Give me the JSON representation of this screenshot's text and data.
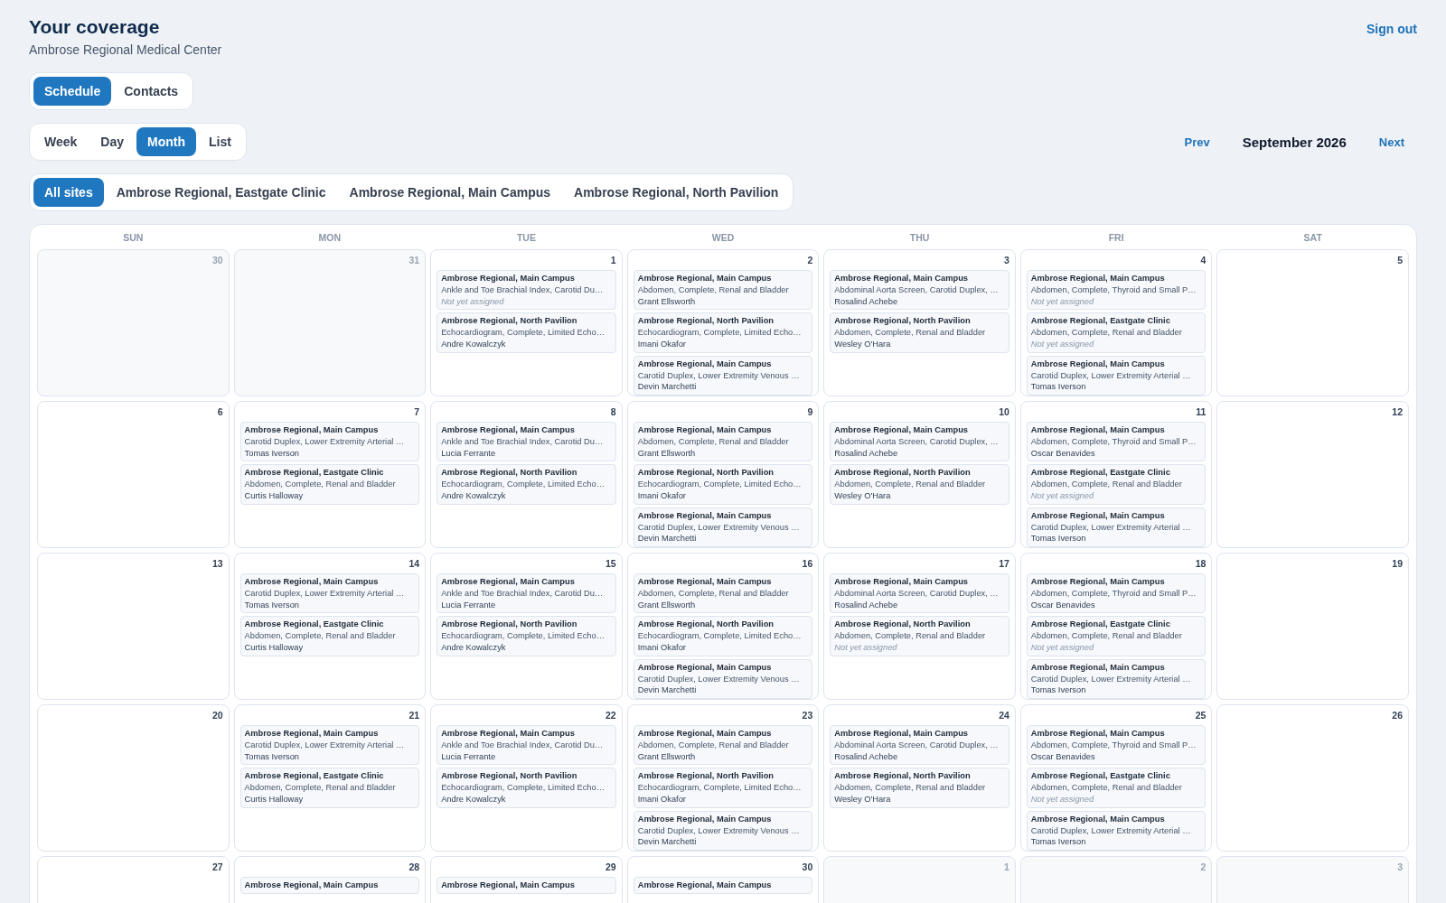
{
  "header": {
    "title": "Your coverage",
    "subtitle": "Ambrose Regional Medical Center",
    "sign_out": "Sign out"
  },
  "tabs": [
    {
      "label": "Schedule",
      "selected": true
    },
    {
      "label": "Contacts",
      "selected": false
    }
  ],
  "views": [
    {
      "label": "Week",
      "selected": false
    },
    {
      "label": "Day",
      "selected": false
    },
    {
      "label": "Month",
      "selected": true
    },
    {
      "label": "List",
      "selected": false
    }
  ],
  "nav": {
    "prev": "Prev",
    "month": "September 2026",
    "next": "Next"
  },
  "sites": [
    {
      "label": "All sites",
      "selected": true
    },
    {
      "label": "Ambrose Regional, Eastgate Clinic",
      "selected": false
    },
    {
      "label": "Ambrose Regional, Main Campus",
      "selected": false
    },
    {
      "label": "Ambrose Regional, North Pavilion",
      "selected": false
    }
  ],
  "calendar": {
    "weekdays": [
      "SUN",
      "MON",
      "TUE",
      "WED",
      "THU",
      "FRI",
      "SAT"
    ],
    "weeks": [
      {
        "days": [
          {
            "day": "30",
            "outside": true
          },
          {
            "day": "31",
            "outside": true
          },
          {
            "day": "1",
            "outside": false,
            "events": [
              {
                "site": "Ambrose Regional, Main Campus",
                "procedure": "Ankle and Toe Brachial Index, Carotid Du…",
                "assignee": "Not yet assigned",
                "assigned": false
              },
              {
                "site": "Ambrose Regional, North Pavilion",
                "procedure": "Echocardiogram, Complete, Limited Echo…",
                "assignee": "Andre Kowalczyk",
                "assigned": true
              }
            ]
          },
          {
            "day": "2",
            "outside": false,
            "events": [
              {
                "site": "Ambrose Regional, Main Campus",
                "procedure": "Abdomen, Complete, Renal and Bladder",
                "assignee": "Grant Ellsworth",
                "assigned": true
              },
              {
                "site": "Ambrose Regional, North Pavilion",
                "procedure": "Echocardiogram, Complete, Limited Echo…",
                "assignee": "Imani Okafor",
                "assigned": true
              },
              {
                "site": "Ambrose Regional, Main Campus",
                "procedure": "Carotid Duplex, Lower Extremity Venous …",
                "assignee": "Devin Marchetti",
                "assigned": true
              }
            ]
          },
          {
            "day": "3",
            "outside": false,
            "events": [
              {
                "site": "Ambrose Regional, Main Campus",
                "procedure": "Abdominal Aorta Screen, Carotid Duplex, …",
                "assignee": "Rosalind Achebe",
                "assigned": true
              },
              {
                "site": "Ambrose Regional, North Pavilion",
                "procedure": "Abdomen, Complete, Renal and Bladder",
                "assignee": "Wesley O'Hara",
                "assigned": true
              }
            ]
          },
          {
            "day": "4",
            "outside": false,
            "events": [
              {
                "site": "Ambrose Regional, Main Campus",
                "procedure": "Abdomen, Complete, Thyroid and Small P…",
                "assignee": "Not yet assigned",
                "assigned": false
              },
              {
                "site": "Ambrose Regional, Eastgate Clinic",
                "procedure": "Abdomen, Complete, Renal and Bladder",
                "assignee": "Not yet assigned",
                "assigned": false
              },
              {
                "site": "Ambrose Regional, Main Campus",
                "procedure": "Carotid Duplex, Lower Extremity Arterial …",
                "assignee": "Tomas Iverson",
                "assigned": true
              }
            ]
          },
          {
            "day": "5",
            "outside": false
          }
        ]
      },
      {
        "days": [
          {
            "day": "6",
            "outside": false
          },
          {
            "day": "7",
            "outside": false,
            "events": [
              {
                "site": "Ambrose Regional, Main Campus",
                "procedure": "Carotid Duplex, Lower Extremity Arterial …",
                "assignee": "Tomas Iverson",
                "assigned": true
              },
              {
                "site": "Ambrose Regional, Eastgate Clinic",
                "procedure": "Abdomen, Complete, Renal and Bladder",
                "assignee": "Curtis Halloway",
                "assigned": true
              }
            ]
          },
          {
            "day": "8",
            "outside": false,
            "events": [
              {
                "site": "Ambrose Regional, Main Campus",
                "procedure": "Ankle and Toe Brachial Index, Carotid Du…",
                "assignee": "Lucia Ferrante",
                "assigned": true
              },
              {
                "site": "Ambrose Regional, North Pavilion",
                "procedure": "Echocardiogram, Complete, Limited Echo…",
                "assignee": "Andre Kowalczyk",
                "assigned": true
              }
            ]
          },
          {
            "day": "9",
            "outside": false,
            "events": [
              {
                "site": "Ambrose Regional, Main Campus",
                "procedure": "Abdomen, Complete, Renal and Bladder",
                "assignee": "Grant Ellsworth",
                "assigned": true
              },
              {
                "site": "Ambrose Regional, North Pavilion",
                "procedure": "Echocardiogram, Complete, Limited Echo…",
                "assignee": "Imani Okafor",
                "assigned": true
              },
              {
                "site": "Ambrose Regional, Main Campus",
                "procedure": "Carotid Duplex, Lower Extremity Venous …",
                "assignee": "Devin Marchetti",
                "assigned": true
              }
            ]
          },
          {
            "day": "10",
            "outside": false,
            "events": [
              {
                "site": "Ambrose Regional, Main Campus",
                "procedure": "Abdominal Aorta Screen, Carotid Duplex, …",
                "assignee": "Rosalind Achebe",
                "assigned": true
              },
              {
                "site": "Ambrose Regional, North Pavilion",
                "procedure": "Abdomen, Complete, Renal and Bladder",
                "assignee": "Wesley O'Hara",
                "assigned": true
              }
            ]
          },
          {
            "day": "11",
            "outside": false,
            "events": [
              {
                "site": "Ambrose Regional, Main Campus",
                "procedure": "Abdomen, Complete, Thyroid and Small P…",
                "assignee": "Oscar Benavides",
                "assigned": true
              },
              {
                "site": "Ambrose Regional, Eastgate Clinic",
                "procedure": "Abdomen, Complete, Renal and Bladder",
                "assignee": "Not yet assigned",
                "assigned": false
              },
              {
                "site": "Ambrose Regional, Main Campus",
                "procedure": "Carotid Duplex, Lower Extremity Arterial …",
                "assignee": "Tomas Iverson",
                "assigned": true
              }
            ]
          },
          {
            "day": "12",
            "outside": false
          }
        ]
      },
      {
        "days": [
          {
            "day": "13",
            "outside": false
          },
          {
            "day": "14",
            "outside": false,
            "events": [
              {
                "site": "Ambrose Regional, Main Campus",
                "procedure": "Carotid Duplex, Lower Extremity Arterial …",
                "assignee": "Tomas Iverson",
                "assigned": true
              },
              {
                "site": "Ambrose Regional, Eastgate Clinic",
                "procedure": "Abdomen, Complete, Renal and Bladder",
                "assignee": "Curtis Halloway",
                "assigned": true
              }
            ]
          },
          {
            "day": "15",
            "outside": false,
            "events": [
              {
                "site": "Ambrose Regional, Main Campus",
                "procedure": "Ankle and Toe Brachial Index, Carotid Du…",
                "assignee": "Lucia Ferrante",
                "assigned": true
              },
              {
                "site": "Ambrose Regional, North Pavilion",
                "procedure": "Echocardiogram, Complete, Limited Echo…",
                "assignee": "Andre Kowalczyk",
                "assigned": true
              }
            ]
          },
          {
            "day": "16",
            "outside": false,
            "events": [
              {
                "site": "Ambrose Regional, Main Campus",
                "procedure": "Abdomen, Complete, Renal and Bladder",
                "assignee": "Grant Ellsworth",
                "assigned": true
              },
              {
                "site": "Ambrose Regional, North Pavilion",
                "procedure": "Echocardiogram, Complete, Limited Echo…",
                "assignee": "Imani Okafor",
                "assigned": true
              },
              {
                "site": "Ambrose Regional, Main Campus",
                "procedure": "Carotid Duplex, Lower Extremity Venous …",
                "assignee": "Devin Marchetti",
                "assigned": true
              }
            ]
          },
          {
            "day": "17",
            "outside": false,
            "events": [
              {
                "site": "Ambrose Regional, Main Campus",
                "procedure": "Abdominal Aorta Screen, Carotid Duplex, …",
                "assignee": "Rosalind Achebe",
                "assigned": true
              },
              {
                "site": "Ambrose Regional, North Pavilion",
                "procedure": "Abdomen, Complete, Renal and Bladder",
                "assignee": "Not yet assigned",
                "assigned": false
              }
            ]
          },
          {
            "day": "18",
            "outside": false,
            "events": [
              {
                "site": "Ambrose Regional, Main Campus",
                "procedure": "Abdomen, Complete, Thyroid and Small P…",
                "assignee": "Oscar Benavides",
                "assigned": true
              },
              {
                "site": "Ambrose Regional, Eastgate Clinic",
                "procedure": "Abdomen, Complete, Renal and Bladder",
                "assignee": "Not yet assigned",
                "assigned": false
              },
              {
                "site": "Ambrose Regional, Main Campus",
                "procedure": "Carotid Duplex, Lower Extremity Arterial …",
                "assignee": "Tomas Iverson",
                "assigned": true
              }
            ]
          },
          {
            "day": "19",
            "outside": false
          }
        ]
      },
      {
        "days": [
          {
            "day": "20",
            "outside": false
          },
          {
            "day": "21",
            "outside": false,
            "events": [
              {
                "site": "Ambrose Regional, Main Campus",
                "procedure": "Carotid Duplex, Lower Extremity Arterial …",
                "assignee": "Tomas Iverson",
                "assigned": true
              },
              {
                "site": "Ambrose Regional, Eastgate Clinic",
                "procedure": "Abdomen, Complete, Renal and Bladder",
                "assignee": "Curtis Halloway",
                "assigned": true
              }
            ]
          },
          {
            "day": "22",
            "outside": false,
            "events": [
              {
                "site": "Ambrose Regional, Main Campus",
                "procedure": "Ankle and Toe Brachial Index, Carotid Du…",
                "assignee": "Lucia Ferrante",
                "assigned": true
              },
              {
                "site": "Ambrose Regional, North Pavilion",
                "procedure": "Echocardiogram, Complete, Limited Echo…",
                "assignee": "Andre Kowalczyk",
                "assigned": true
              }
            ]
          },
          {
            "day": "23",
            "outside": false,
            "events": [
              {
                "site": "Ambrose Regional, Main Campus",
                "procedure": "Abdomen, Complete, Renal and Bladder",
                "assignee": "Grant Ellsworth",
                "assigned": true
              },
              {
                "site": "Ambrose Regional, North Pavilion",
                "procedure": "Echocardiogram, Complete, Limited Echo…",
                "assignee": "Imani Okafor",
                "assigned": true
              },
              {
                "site": "Ambrose Regional, Main Campus",
                "procedure": "Carotid Duplex, Lower Extremity Venous …",
                "assignee": "Devin Marchetti",
                "assigned": true
              }
            ]
          },
          {
            "day": "24",
            "outside": false,
            "events": [
              {
                "site": "Ambrose Regional, Main Campus",
                "procedure": "Abdominal Aorta Screen, Carotid Duplex, …",
                "assignee": "Rosalind Achebe",
                "assigned": true
              },
              {
                "site": "Ambrose Regional, North Pavilion",
                "procedure": "Abdomen, Complete, Renal and Bladder",
                "assignee": "Wesley O'Hara",
                "assigned": true
              }
            ]
          },
          {
            "day": "25",
            "outside": false,
            "events": [
              {
                "site": "Ambrose Regional, Main Campus",
                "procedure": "Abdomen, Complete, Thyroid and Small P…",
                "assignee": "Oscar Benavides",
                "assigned": true
              },
              {
                "site": "Ambrose Regional, Eastgate Clinic",
                "procedure": "Abdomen, Complete, Renal and Bladder",
                "assignee": "Not yet assigned",
                "assigned": false
              },
              {
                "site": "Ambrose Regional, Main Campus",
                "procedure": "Carotid Duplex, Lower Extremity Arterial …",
                "assignee": "Tomas Iverson",
                "assigned": true
              }
            ]
          },
          {
            "day": "26",
            "outside": false
          }
        ]
      },
      {
        "days": [
          {
            "day": "27",
            "outside": false
          },
          {
            "day": "28",
            "outside": false,
            "events": [
              {
                "site": "Ambrose Regional, Main Campus"
              }
            ]
          },
          {
            "day": "29",
            "outside": false,
            "events": [
              {
                "site": "Ambrose Regional, Main Campus"
              }
            ]
          },
          {
            "day": "30",
            "outside": false,
            "events": [
              {
                "site": "Ambrose Regional, Main Campus"
              }
            ]
          },
          {
            "day": "1",
            "outside": true
          },
          {
            "day": "2",
            "outside": true
          },
          {
            "day": "3",
            "outside": true
          }
        ]
      }
    ]
  }
}
